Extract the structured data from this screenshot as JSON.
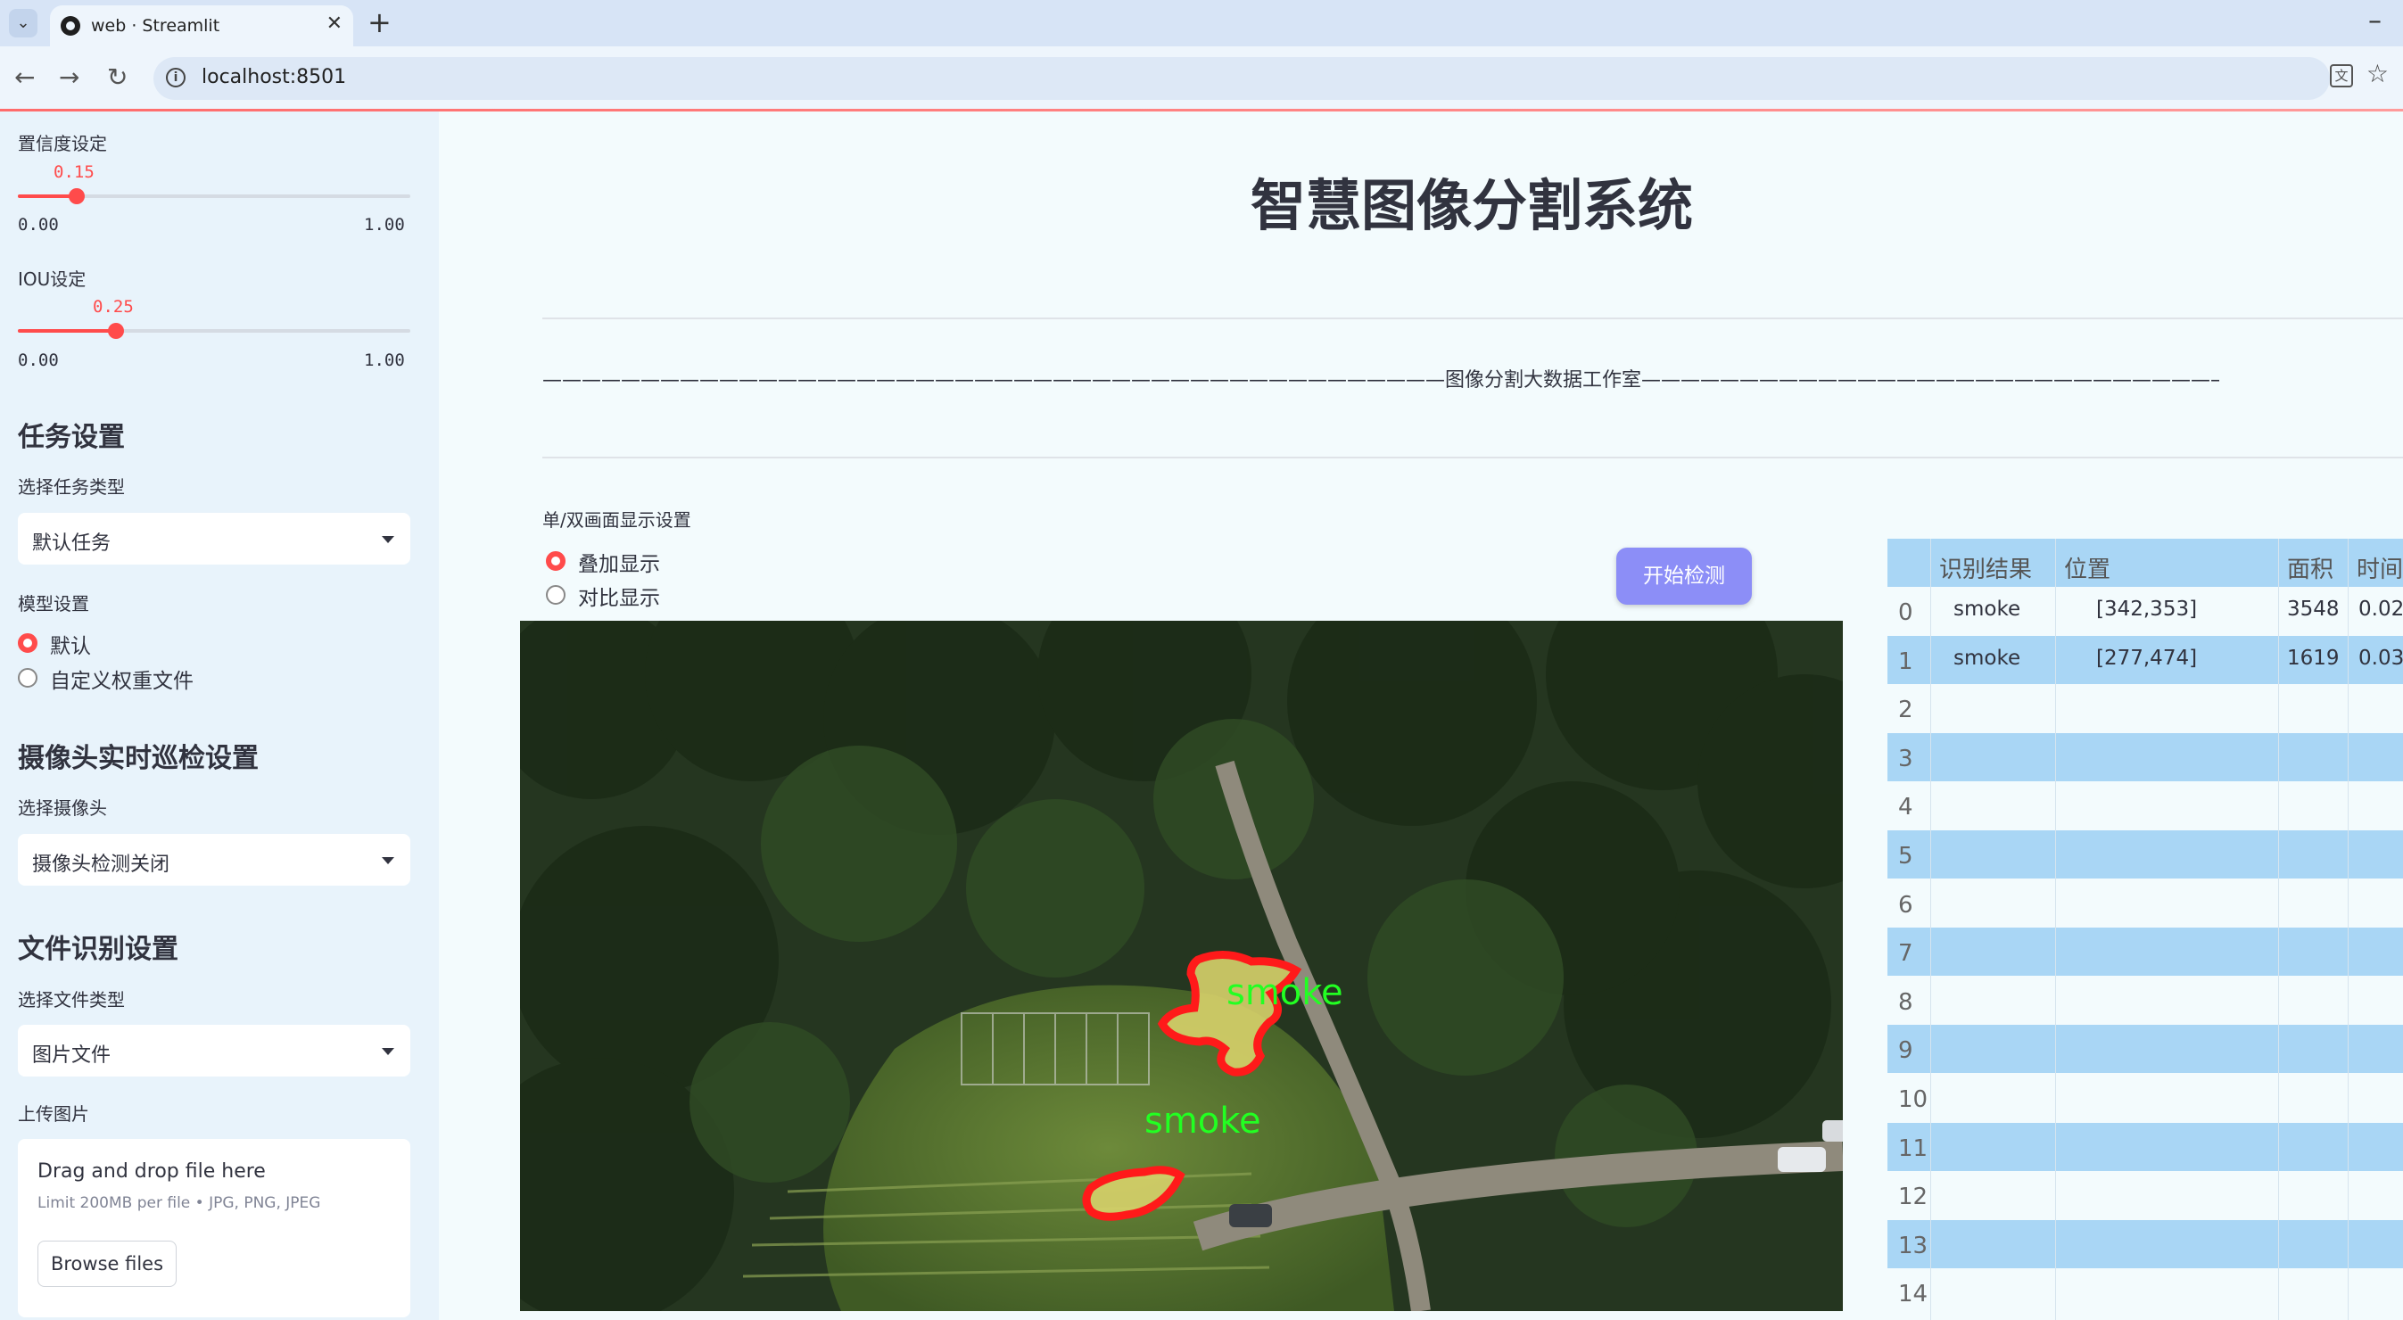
{
  "browser": {
    "tab_title": "web · Streamlit",
    "url": "localhost:8501"
  },
  "sidebar": {
    "confidence": {
      "label": "置信度设定",
      "value": "0.15",
      "fraction": 0.15,
      "min": "0.00",
      "max": "1.00"
    },
    "iou": {
      "label": "IOU设定",
      "value": "0.25",
      "fraction": 0.25,
      "min": "0.00",
      "max": "1.00"
    },
    "task": {
      "header": "任务设置",
      "label": "选择任务类型",
      "selected": "默认任务"
    },
    "model": {
      "label": "模型设置",
      "options": [
        "默认",
        "自定义权重文件"
      ],
      "selected_index": 0
    },
    "camera": {
      "header": "摄像头实时巡检设置",
      "label": "选择摄像头",
      "selected": "摄像头检测关闭"
    },
    "file": {
      "header": "文件识别设置",
      "label": "选择文件类型",
      "selected": "图片文件"
    },
    "upload": {
      "label": "上传图片",
      "drop_text": "Drag and drop file here",
      "limit_text": "Limit 200MB per file • JPG, PNG, JPEG",
      "button": "Browse files"
    }
  },
  "main": {
    "title": "智慧图像分割系统",
    "studio_line": "——————————————————————————————————————————————图像分割大数据工作室—————————————————————————————————————————————————",
    "display_label": "单/双画面显示设置",
    "display_options": [
      "叠加显示",
      "对比显示"
    ],
    "display_selected_index": 0,
    "start_button": "开始检测",
    "image_labels": [
      "smoke",
      "smoke"
    ]
  },
  "table": {
    "columns": [
      "",
      "识别结果",
      "位置",
      "面积",
      "时间"
    ],
    "rows": [
      {
        "index": "0",
        "result": "smoke",
        "position": "[342,353]",
        "area": "3548",
        "time": "0.02"
      },
      {
        "index": "1",
        "result": "smoke",
        "position": "[277,474]",
        "area": "1619",
        "time": "0.03"
      },
      {
        "index": "2"
      },
      {
        "index": "3"
      },
      {
        "index": "4"
      },
      {
        "index": "5"
      },
      {
        "index": "6"
      },
      {
        "index": "7"
      },
      {
        "index": "8"
      },
      {
        "index": "9"
      },
      {
        "index": "10"
      },
      {
        "index": "11"
      },
      {
        "index": "12"
      },
      {
        "index": "13"
      },
      {
        "index": "14"
      }
    ]
  },
  "colors": {
    "accent": "#ff4b4b",
    "button": "#8c8ef7",
    "table_stripe": "#a9d6f5",
    "sidebar_bg": "#e8f3fb",
    "mask_fill": "#d7d26a",
    "mask_outline": "#ff1a1a",
    "label_text": "#22ff22"
  }
}
